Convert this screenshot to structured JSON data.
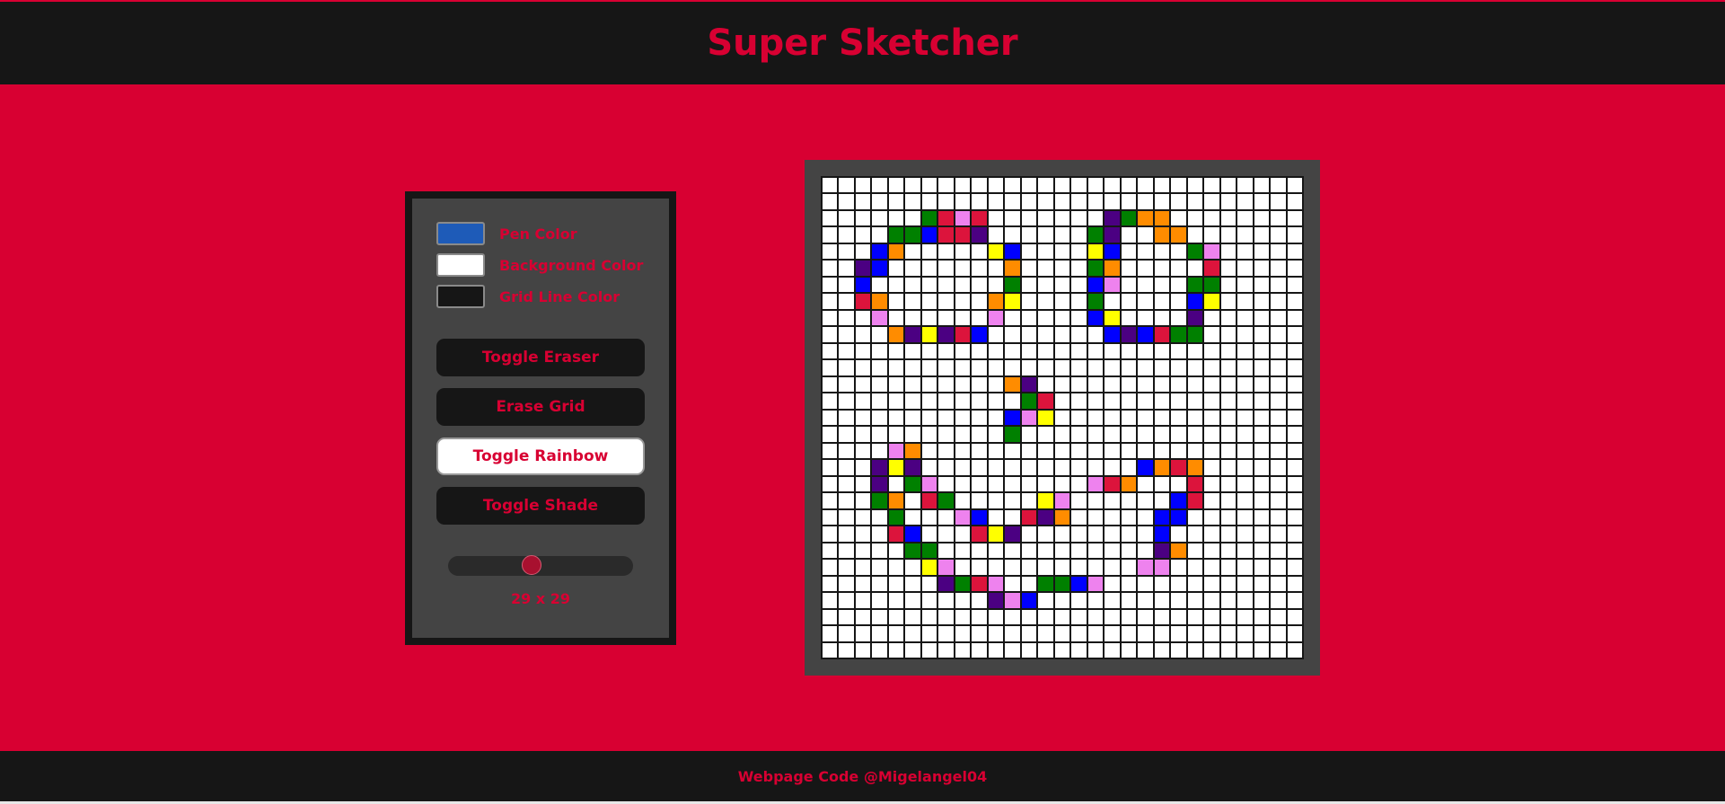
{
  "header": {
    "title": "Super Sketcher"
  },
  "controls": {
    "pen_color": {
      "label": "Pen Color",
      "value": "#1e5bb8"
    },
    "background_color": {
      "label": "Background Color",
      "value": "#ffffff"
    },
    "grid_line_color": {
      "label": "Grid Line Color",
      "value": "#161616"
    },
    "buttons": {
      "toggle_eraser": "Toggle Eraser",
      "erase_grid": "Erase Grid",
      "toggle_rainbow": "Toggle Rainbow",
      "toggle_shade": "Toggle Shade"
    },
    "active_button": "toggle_rainbow",
    "grid_size": {
      "value": 29,
      "min": 1,
      "max": 64,
      "label": "29 x 29"
    }
  },
  "canvas": {
    "cols": 29,
    "rows": 29,
    "background": "#ffffff",
    "grid_line_color": "#161616",
    "palette": {
      "R": "#dc143c",
      "O": "#ff8c00",
      "Y": "#ffff00",
      "G": "#008000",
      "B": "#0000ff",
      "P": "#4b0082",
      "V": "#ee82ee"
    },
    "pixels": [
      ".............................",
      ".............................",
      "......GRVR.......PGOO........",
      "....GGBRRP......GP..OO.......",
      "...BO.....YB....YB....GV.....",
      "..PB.......O....GO.....R.....",
      "..B........G....BV....GG.....",
      "..RO......OY....G.....BY.....",
      "...V......V.....BY....P......",
      "....OPYPRB.......BPBRGG......",
      ".............................",
      ".............................",
      "...........OP................",
      "............GR...............",
      "...........BVY...............",
      "...........G.................",
      "....VO.......................",
      "...PYP.............BORO.......",
      "...P.GV.........VRO...R......",
      "...GO.RG.....YV......BR......",
      "....G...VB..RPO.....BB.......",
      "....RB...RYP........B........",
      ".....GG.............PO.......",
      "......YV...........VV........",
      ".......PGRV..GGBV............",
      "..........PVB................",
      ".............................",
      ".............................",
      "............................."
    ]
  },
  "footer": {
    "text": "Webpage Code @Migelangel04"
  }
}
